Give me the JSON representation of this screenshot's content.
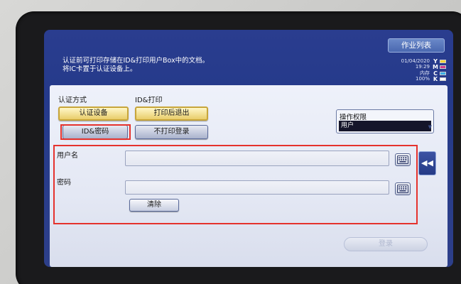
{
  "header": {
    "message_line1": "认证前可打印存储在ID&打印用户Box中的文档。",
    "message_line2": "将IC卡置于认证设备上。",
    "job_list_label": "作业列表",
    "date": "01/04/2020",
    "time": "19:29",
    "memory_label": "内存",
    "memory_value": "100%",
    "toner": [
      "Y",
      "M",
      "C",
      "K"
    ]
  },
  "auth": {
    "section_label": "认证方式",
    "auth_device_label": "认证设备",
    "id_password_label": "ID&密码"
  },
  "id_print": {
    "section_label": "ID&打印",
    "print_logout_label": "打印后退出",
    "no_print_login_label": "不打印登录"
  },
  "permission": {
    "label": "操作权限",
    "value": "用户"
  },
  "form": {
    "username_label": "用户名",
    "password_label": "密码",
    "clear_label": "清除",
    "ok_label": "登录"
  },
  "colors": {
    "screen_blue": "#253a8a",
    "highlight_red": "#e5322d",
    "selected_yellow": "#e9cd6a",
    "toner_yellow": "#f2d53a",
    "toner_magenta": "#d23c8c",
    "toner_cyan": "#3ab0e8",
    "toner_black": "#ffffff"
  }
}
